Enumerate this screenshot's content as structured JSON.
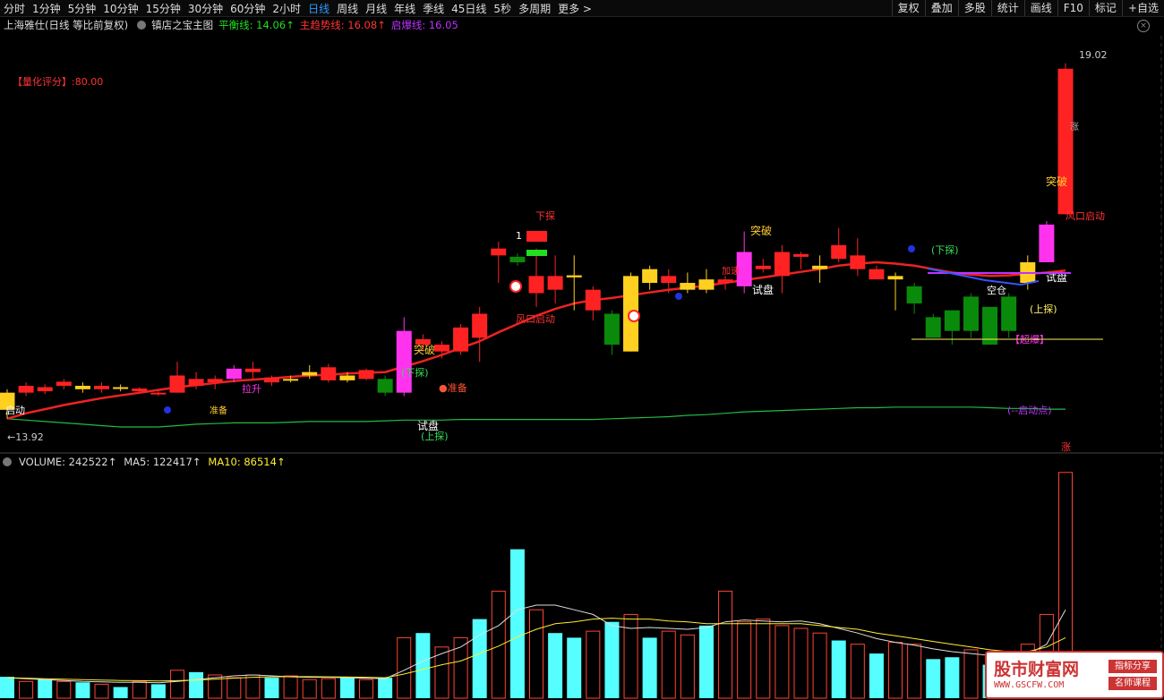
{
  "toolbar": {
    "periods": [
      "分时",
      "1分钟",
      "5分钟",
      "10分钟",
      "15分钟",
      "30分钟",
      "60分钟",
      "2小时",
      "日线",
      "周线",
      "月线",
      "年线",
      "季线",
      "45日线",
      "5秒",
      "多周期",
      "更多 >"
    ],
    "active": "日线",
    "tools": [
      "复权",
      "叠加",
      "多股",
      "统计",
      "画线",
      "F10",
      "标记",
      "+自选"
    ]
  },
  "header": {
    "stock": "上海雅仕(日线 等比前复权)",
    "indicator": "镇店之宝主图",
    "lines": [
      {
        "label": "平衡线: 14.06↑",
        "color": "#22dd22"
      },
      {
        "label": "主趋势线: 16.08↑",
        "color": "#ff3333"
      },
      {
        "label": "启爆线: 16.05",
        "color": "#bb33ff"
      }
    ]
  },
  "score_label": "【量化评分】:80.00",
  "price_labels": {
    "high": "19.02",
    "low": "13.92"
  },
  "volume_header": {
    "volume": "VOLUME: 242522↑",
    "ma5": "MA5: 122417↑",
    "ma10": "MA10: 86514↑"
  },
  "chart_labels": {
    "tupo1": "突破",
    "tupo2": "突破",
    "tupo3": "突破",
    "shipan1": "试盘",
    "shipan2": "试盘",
    "shipan3": "试盘",
    "xiatan1": "(下探)",
    "xiatan2": "(下探)",
    "shangtan1": "(上探)",
    "shangtan2": "(上探)",
    "zhunbei": "●准备",
    "fengkou1": "风口启动",
    "fengkou2": "风口启动",
    "xiatan_top": "下探",
    "one": "1",
    "kongcang": "空仓",
    "chaobao": "【超爆】",
    "qidongdian": "(--启动点)",
    "zhang": "涨",
    "qishi": "启动",
    "lasheng": "拉升",
    "zhang2": "涨",
    "zhunbei2": "准备",
    "jiasu": "加速"
  },
  "colors": {
    "up": "#ff2222",
    "down": "#0a8a0a",
    "yellow": "#ffd020",
    "magenta": "#ff33ee",
    "cyan": "#55ffff",
    "red_line": "#ee2222",
    "green_line": "#22bb44",
    "blue_line": "#3355ff"
  },
  "watermark": {
    "title": "股市财富网",
    "url": "WWW.GSCFW.COM",
    "tag1": "指标分享",
    "tag2": "名师课程"
  },
  "chart_data": {
    "type": "candlestick",
    "ylim": [
      13.5,
      19.5
    ],
    "candles": [
      {
        "o": 14.05,
        "c": 14.3,
        "h": 14.35,
        "l": 13.92,
        "col": "yellow"
      },
      {
        "o": 14.3,
        "c": 14.4,
        "h": 14.45,
        "l": 14.25,
        "col": "up"
      },
      {
        "o": 14.38,
        "c": 14.32,
        "h": 14.42,
        "l": 14.28,
        "col": "up"
      },
      {
        "o": 14.4,
        "c": 14.46,
        "h": 14.5,
        "l": 14.35,
        "col": "up"
      },
      {
        "o": 14.35,
        "c": 14.4,
        "h": 14.45,
        "l": 14.3,
        "col": "yellow"
      },
      {
        "o": 14.35,
        "c": 14.4,
        "h": 14.45,
        "l": 14.3,
        "col": "up"
      },
      {
        "o": 14.37,
        "c": 14.38,
        "h": 14.42,
        "l": 14.32,
        "col": "yellow"
      },
      {
        "o": 14.32,
        "c": 14.36,
        "h": 14.38,
        "l": 14.3,
        "col": "up"
      },
      {
        "o": 14.28,
        "c": 14.3,
        "h": 14.35,
        "l": 14.25,
        "col": "up"
      },
      {
        "o": 14.3,
        "c": 14.55,
        "h": 14.75,
        "l": 14.3,
        "col": "up"
      },
      {
        "o": 14.4,
        "c": 14.5,
        "h": 14.6,
        "l": 14.35,
        "col": "up"
      },
      {
        "o": 14.5,
        "c": 14.45,
        "h": 14.55,
        "l": 14.35,
        "col": "up"
      },
      {
        "o": 14.5,
        "c": 14.65,
        "h": 14.7,
        "l": 14.45,
        "col": "magenta"
      },
      {
        "o": 14.6,
        "c": 14.65,
        "h": 14.75,
        "l": 14.5,
        "col": "up"
      },
      {
        "o": 14.45,
        "c": 14.52,
        "h": 14.55,
        "l": 14.4,
        "col": "up"
      },
      {
        "o": 14.5,
        "c": 14.48,
        "h": 14.55,
        "l": 14.45,
        "col": "yellow"
      },
      {
        "o": 14.55,
        "c": 14.6,
        "h": 14.7,
        "l": 14.5,
        "col": "yellow"
      },
      {
        "o": 14.48,
        "c": 14.67,
        "h": 14.72,
        "l": 14.45,
        "col": "up"
      },
      {
        "o": 14.48,
        "c": 14.55,
        "h": 14.6,
        "l": 14.45,
        "col": "yellow"
      },
      {
        "o": 14.5,
        "c": 14.63,
        "h": 14.65,
        "l": 14.48,
        "col": "up"
      },
      {
        "o": 14.5,
        "c": 14.3,
        "h": 14.55,
        "l": 14.25,
        "col": "down"
      },
      {
        "o": 14.3,
        "c": 15.2,
        "h": 15.4,
        "l": 14.25,
        "col": "magenta"
      },
      {
        "o": 15.0,
        "c": 15.08,
        "h": 15.15,
        "l": 14.9,
        "col": "up"
      },
      {
        "o": 14.9,
        "c": 15.0,
        "h": 15.05,
        "l": 14.8,
        "col": "up"
      },
      {
        "o": 14.9,
        "c": 15.25,
        "h": 15.3,
        "l": 14.85,
        "col": "up"
      },
      {
        "o": 15.1,
        "c": 15.45,
        "h": 15.55,
        "l": 14.75,
        "col": "up"
      },
      {
        "o": 16.3,
        "c": 16.4,
        "h": 16.5,
        "l": 15.9,
        "col": "up"
      },
      {
        "o": 16.2,
        "c": 16.28,
        "h": 16.33,
        "l": 16.15,
        "col": "down"
      },
      {
        "o": 15.75,
        "c": 16.0,
        "h": 16.4,
        "l": 15.55,
        "col": "up"
      },
      {
        "o": 15.8,
        "c": 16.0,
        "h": 16.3,
        "l": 15.6,
        "col": "up"
      },
      {
        "o": 15.98,
        "c": 16.01,
        "h": 16.3,
        "l": 15.5,
        "col": "yellow"
      },
      {
        "o": 15.5,
        "c": 15.8,
        "h": 15.85,
        "l": 15.35,
        "col": "up"
      },
      {
        "o": 15.0,
        "c": 15.45,
        "h": 15.5,
        "l": 14.85,
        "col": "down"
      },
      {
        "o": 14.9,
        "c": 16.0,
        "h": 16.05,
        "l": 14.9,
        "col": "yellow"
      },
      {
        "o": 15.9,
        "c": 16.1,
        "h": 16.15,
        "l": 15.8,
        "col": "yellow"
      },
      {
        "o": 15.9,
        "c": 16.0,
        "h": 16.1,
        "l": 15.75,
        "col": "up"
      },
      {
        "o": 15.8,
        "c": 15.9,
        "h": 16.05,
        "l": 15.75,
        "col": "yellow"
      },
      {
        "o": 15.8,
        "c": 15.95,
        "h": 16.1,
        "l": 15.75,
        "col": "yellow"
      },
      {
        "o": 15.9,
        "c": 15.95,
        "h": 16.0,
        "l": 15.8,
        "col": "up"
      },
      {
        "o": 15.85,
        "c": 16.35,
        "h": 16.65,
        "l": 15.75,
        "col": "magenta"
      },
      {
        "o": 16.1,
        "c": 16.15,
        "h": 16.25,
        "l": 16.05,
        "col": "up"
      },
      {
        "o": 16.0,
        "c": 16.35,
        "h": 16.45,
        "l": 15.75,
        "col": "up"
      },
      {
        "o": 16.28,
        "c": 16.32,
        "h": 16.35,
        "l": 16.1,
        "col": "up"
      },
      {
        "o": 16.1,
        "c": 16.15,
        "h": 16.3,
        "l": 15.9,
        "col": "yellow"
      },
      {
        "o": 16.25,
        "c": 16.45,
        "h": 16.7,
        "l": 16.2,
        "col": "up"
      },
      {
        "o": 16.1,
        "c": 16.3,
        "h": 16.55,
        "l": 16.0,
        "col": "up"
      },
      {
        "o": 15.95,
        "c": 16.1,
        "h": 16.15,
        "l": 15.95,
        "col": "up"
      },
      {
        "o": 15.95,
        "c": 16.0,
        "h": 16.05,
        "l": 15.5,
        "col": "yellow"
      },
      {
        "o": 15.6,
        "c": 15.85,
        "h": 15.9,
        "l": 15.45,
        "col": "down"
      },
      {
        "o": 15.1,
        "c": 15.4,
        "h": 15.45,
        "l": 15.1,
        "col": "down"
      },
      {
        "o": 15.2,
        "c": 15.5,
        "h": 15.5,
        "l": 15.0,
        "col": "down"
      },
      {
        "o": 15.2,
        "c": 15.7,
        "h": 15.75,
        "l": 15.1,
        "col": "down"
      },
      {
        "o": 15.0,
        "c": 15.55,
        "h": 15.55,
        "l": 15.0,
        "col": "down"
      },
      {
        "o": 15.2,
        "c": 15.7,
        "h": 15.75,
        "l": 15.1,
        "col": "down"
      },
      {
        "o": 15.9,
        "c": 16.2,
        "h": 16.3,
        "l": 15.8,
        "col": "yellow"
      },
      {
        "o": 16.2,
        "c": 16.75,
        "h": 16.8,
        "l": 16.2,
        "col": "magenta"
      },
      {
        "o": 16.9,
        "c": 19.02,
        "h": 19.1,
        "l": 16.9,
        "col": "up"
      }
    ],
    "balance_line": [
      13.92,
      13.9,
      13.88,
      13.86,
      13.84,
      13.82,
      13.8,
      13.8,
      13.8,
      13.82,
      13.84,
      13.85,
      13.86,
      13.86,
      13.86,
      13.87,
      13.88,
      13.88,
      13.88,
      13.88,
      13.89,
      13.9,
      13.9,
      13.9,
      13.91,
      13.91,
      13.91,
      13.91,
      13.91,
      13.91,
      13.91,
      13.91,
      13.92,
      13.93,
      13.94,
      13.95,
      13.97,
      13.98,
      14.0,
      14.02,
      14.03,
      14.04,
      14.05,
      14.06,
      14.07,
      14.08,
      14.08,
      14.09,
      14.09,
      14.09,
      14.09,
      14.09,
      14.08,
      14.07,
      14.07,
      14.06,
      14.06
    ],
    "trend_line": [
      13.92,
      14.0,
      14.06,
      14.12,
      14.17,
      14.22,
      14.26,
      14.3,
      14.34,
      14.38,
      14.41,
      14.44,
      14.47,
      14.49,
      14.51,
      14.53,
      14.55,
      14.56,
      14.58,
      14.59,
      14.6,
      14.68,
      14.76,
      14.85,
      14.95,
      15.05,
      15.18,
      15.3,
      15.42,
      15.52,
      15.6,
      15.65,
      15.68,
      15.72,
      15.76,
      15.8,
      15.83,
      15.86,
      15.9,
      15.94,
      15.98,
      16.02,
      16.06,
      16.1,
      16.15,
      16.18,
      16.2,
      16.18,
      16.15,
      16.1,
      16.05,
      16.02,
      16.0,
      16.01,
      16.03,
      16.05,
      16.08
    ],
    "volume": {
      "max": 250000,
      "values": [
        23000,
        18000,
        20000,
        18000,
        17000,
        15000,
        12000,
        18000,
        15000,
        30000,
        28000,
        25000,
        22000,
        25000,
        22000,
        24000,
        20000,
        21000,
        22000,
        20000,
        22000,
        65000,
        70000,
        55000,
        65000,
        85000,
        115000,
        160000,
        95000,
        70000,
        65000,
        72000,
        82000,
        90000,
        65000,
        72000,
        68000,
        78000,
        115000,
        82000,
        85000,
        78000,
        75000,
        70000,
        62000,
        58000,
        48000,
        60000,
        58000,
        42000,
        44000,
        52000,
        36000,
        40000,
        58000,
        90000,
        242522
      ],
      "fill": [
        1,
        0,
        1,
        0,
        1,
        0,
        1,
        0,
        1,
        0,
        1,
        0,
        0,
        0,
        1,
        0,
        0,
        0,
        1,
        0,
        1,
        0,
        1,
        0,
        0,
        1,
        0,
        1,
        0,
        1,
        1,
        0,
        1,
        0,
        1,
        0,
        0,
        1,
        0,
        0,
        0,
        0,
        0,
        0,
        1,
        0,
        1,
        0,
        0,
        1,
        1,
        0,
        1,
        0,
        0,
        0,
        0
      ],
      "ma5": [
        22000,
        21000,
        20000,
        19000,
        18000,
        17500,
        17000,
        17000,
        16500,
        18000,
        20000,
        22000,
        24000,
        25000,
        24000,
        23000,
        22500,
        22500,
        22000,
        21500,
        21000,
        30000,
        40000,
        48000,
        55000,
        68000,
        78000,
        95000,
        100000,
        100000,
        95000,
        90000,
        78000,
        75000,
        76000,
        75000,
        74000,
        76000,
        82000,
        84000,
        83000,
        82000,
        83000,
        80000,
        75000,
        70000,
        64000,
        60000,
        57000,
        53000,
        50000,
        48000,
        46000,
        45000,
        47000,
        58000,
        95000
      ],
      "ma10": [
        22000,
        21500,
        21000,
        20500,
        20000,
        19500,
        19000,
        18800,
        18500,
        18800,
        19500,
        20500,
        21500,
        22500,
        23000,
        23200,
        23200,
        23000,
        22800,
        22500,
        22000,
        26000,
        31000,
        36000,
        40000,
        48000,
        56000,
        66000,
        74000,
        80000,
        82000,
        85000,
        86000,
        85000,
        85000,
        83000,
        82000,
        80000,
        80000,
        80000,
        80000,
        80000,
        80000,
        78000,
        76000,
        74000,
        70000,
        67000,
        64000,
        61000,
        58000,
        55000,
        52000,
        50000,
        50000,
        55000,
        65000
      ]
    }
  }
}
